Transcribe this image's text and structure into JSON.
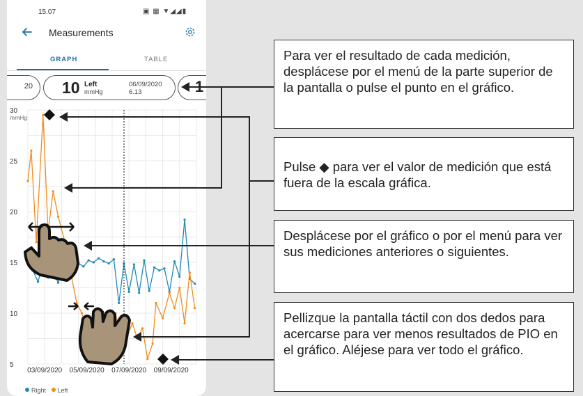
{
  "status": {
    "time": "15.07",
    "icons": "▣ ▦ ▼◢◢▮"
  },
  "header": {
    "title": "Measurements"
  },
  "tabs": [
    "GRAPH",
    "TABLE"
  ],
  "selected_tab": "GRAPH",
  "menu": {
    "prev_value": "20",
    "current": {
      "value": "10",
      "eye": "Left",
      "unit": "mmHg",
      "date": "06/09/2020",
      "time": "6.13"
    },
    "next_value": "1"
  },
  "colors": {
    "right": "#1f89b6",
    "left": "#f28c1e",
    "accent": "#1c6ea4"
  },
  "chart_data": {
    "type": "line",
    "yunit": "mmHg",
    "ylim": [
      5,
      30
    ],
    "yticks": [
      "30",
      "25",
      "20",
      "15",
      "10",
      "5"
    ],
    "xticks": [
      "03/09/2020",
      "05/09/2020",
      "07/09/2020",
      "09/09/2020"
    ],
    "grid": true,
    "legend": [
      {
        "name": "Right",
        "color": "#1f89b6"
      },
      {
        "name": "Left",
        "color": "#f28c1e"
      }
    ],
    "series": [
      {
        "name": "Right",
        "color": "#1f89b6",
        "x": [
          0,
          0.15,
          0.3,
          0.45,
          0.6,
          0.75,
          0.9,
          1.05,
          1.2,
          1.35,
          1.5,
          1.65,
          1.8,
          1.95,
          2.1,
          2.25,
          2.4,
          2.55,
          2.7,
          2.85,
          3.0,
          3.15,
          3.3,
          3.45,
          3.6,
          3.75,
          3.9,
          4.05,
          4.2,
          4.35,
          4.5,
          4.65,
          4.8,
          4.95
        ],
        "values": [
          15.5,
          14.2,
          13.1,
          14.8,
          13.5,
          14.1,
          13.0,
          14.5,
          14.6,
          14.8,
          14.9,
          14.6,
          15.2,
          15.0,
          15.4,
          15.1,
          14.9,
          15.3,
          11.0,
          14.9,
          12.1,
          14.8,
          12.0,
          15.2,
          12.2,
          14.5,
          14.2,
          14.4,
          12.1,
          15.1,
          13.6,
          19.2,
          13.4,
          12.9
        ]
      },
      {
        "name": "Left",
        "color": "#f28c1e",
        "x": [
          0,
          0.1,
          0.25,
          0.45,
          0.6,
          0.75,
          0.9,
          1.1,
          1.3,
          1.45,
          1.6,
          1.8,
          2.0,
          2.2,
          2.45,
          2.6,
          2.8,
          2.95,
          3.1,
          3.25,
          3.4,
          3.55,
          3.7,
          3.8,
          4.0,
          4.2,
          4.35,
          4.5,
          4.65,
          4.8,
          4.95
        ],
        "values": [
          23.0,
          26.0,
          17.0,
          29.5,
          18.0,
          22.0,
          19.5,
          17.0,
          13.5,
          11.0,
          10.0,
          8.0,
          7.0,
          6.5,
          7.0,
          10.0,
          6.5,
          7.8,
          9.0,
          7.5,
          8.5,
          5.5,
          7.0,
          11.0,
          9.5,
          12.0,
          10.5,
          12.5,
          9.0,
          14.0,
          10.5
        ]
      }
    ],
    "out_of_range_markers": 2
  },
  "legend_labels": {
    "right": "Right",
    "left": "Left"
  },
  "callouts": [
    "Para ver el resultado de cada medición, desplácese por el menú de la parte superior de la pantalla o pulse el punto en el gráfico.",
    "Pulse ◆ para ver el valor de medición que está fuera de la escala gráfica.",
    "Desplácese por el gráfico o por el menú para ver sus mediciones anteriores o siguientes.",
    "Pellizque la pantalla táctil con dos dedos para acercarse para ver menos resultados de PIO en el gráfico. Aléjese para ver todo el gráfico."
  ]
}
